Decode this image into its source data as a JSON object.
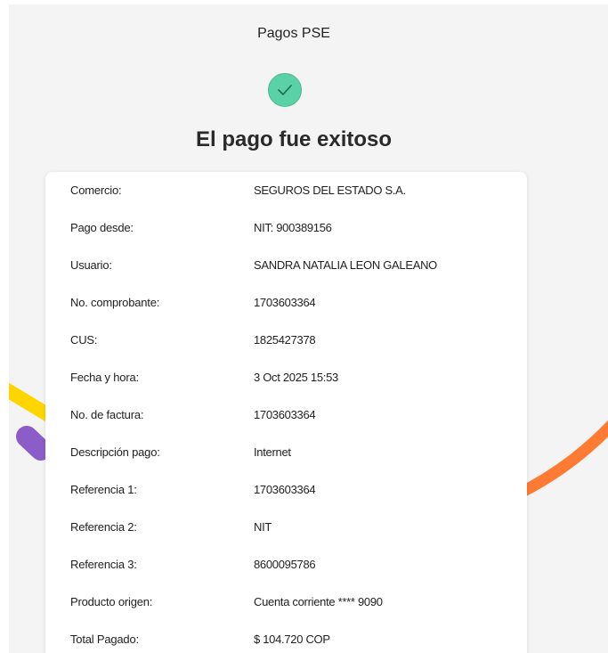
{
  "header": {
    "title": "Pagos PSE"
  },
  "status": {
    "heading": "El pago fue exitoso",
    "icon": "check-circle-icon",
    "accent": "#5ad1a6"
  },
  "decor": {
    "yellow": "#ffd500",
    "purple": "#8c5cc9",
    "orange": "#ff7a33"
  },
  "details": [
    {
      "label": "Comercio:",
      "value": "SEGUROS DEL ESTADO S.A."
    },
    {
      "label": "Pago desde:",
      "value": "NIT: 900389156"
    },
    {
      "label": "Usuario:",
      "value": "SANDRA NATALIA LEON GALEANO"
    },
    {
      "label": "No. comprobante:",
      "value": "1703603364"
    },
    {
      "label": "CUS:",
      "value": "1825427378"
    },
    {
      "label": "Fecha y hora:",
      "value": "3 Oct 2025 15:53"
    },
    {
      "label": "No. de factura:",
      "value": "1703603364"
    },
    {
      "label": "Descripción pago:",
      "value": "Internet"
    },
    {
      "label": "Referencia 1:",
      "value": "1703603364"
    },
    {
      "label": "Referencia 2:",
      "value": "NIT"
    },
    {
      "label": "Referencia 3:",
      "value": "8600095786"
    },
    {
      "label": "Producto origen:",
      "value": "Cuenta corriente **** 9090"
    },
    {
      "label": "Total Pagado:",
      "value": "$ 104.720 COP"
    }
  ]
}
